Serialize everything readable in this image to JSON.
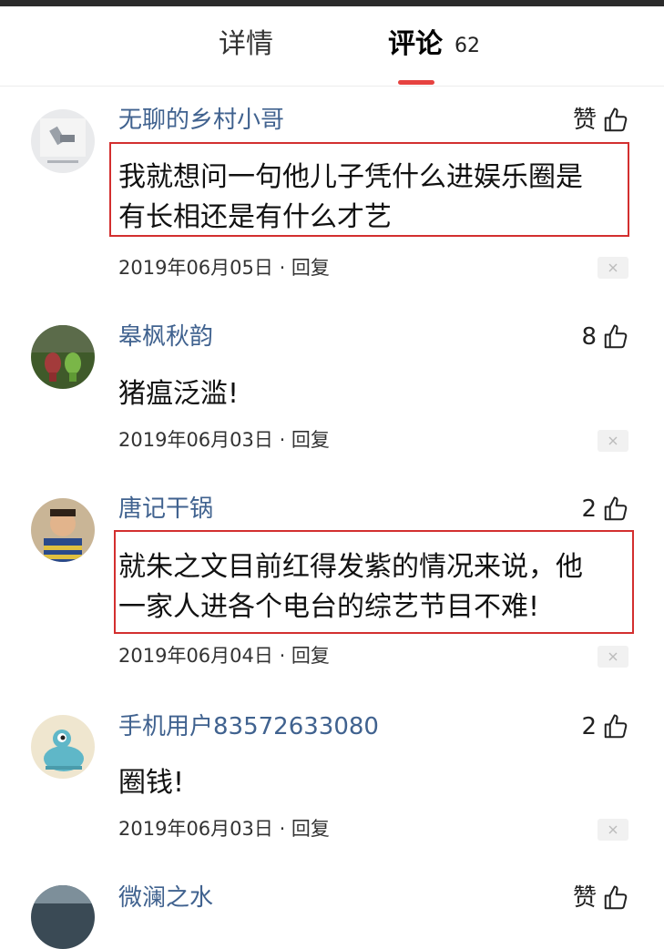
{
  "tabs": {
    "details_label": "详情",
    "comments_label": "评论",
    "comments_count": "62",
    "active_color": "#e64340"
  },
  "colors": {
    "username": "#40628f",
    "highlight_border": "#d32f2f"
  },
  "comments": [
    {
      "user": "无聊的乡村小哥",
      "like_label": "赞",
      "text_lines": [
        "我就想问一句他儿子凭什么进娱乐圈是",
        "有长相还是有什么才艺"
      ],
      "date": "2019年06月05日",
      "reply_label": "回复",
      "highlighted": true
    },
    {
      "user": "皋枫秋韵",
      "like_label": "8",
      "text_lines": [
        "猪瘟泛滥!"
      ],
      "date": "2019年06月03日",
      "reply_label": "回复",
      "highlighted": false
    },
    {
      "user": "唐记干锅",
      "like_label": "2",
      "text_lines": [
        "就朱之文目前红得发紫的情况来说，他",
        "一家人进各个电台的综艺节目不难!"
      ],
      "date": "2019年06月04日",
      "reply_label": "回复",
      "highlighted": true
    },
    {
      "user": "手机用户83572633080",
      "like_label": "2",
      "text_lines": [
        "圈钱!"
      ],
      "date": "2019年06月03日",
      "reply_label": "回复",
      "highlighted": false
    },
    {
      "user": "微澜之水",
      "like_label": "赞",
      "text_lines": [],
      "date": "",
      "reply_label": "",
      "highlighted": false
    }
  ]
}
